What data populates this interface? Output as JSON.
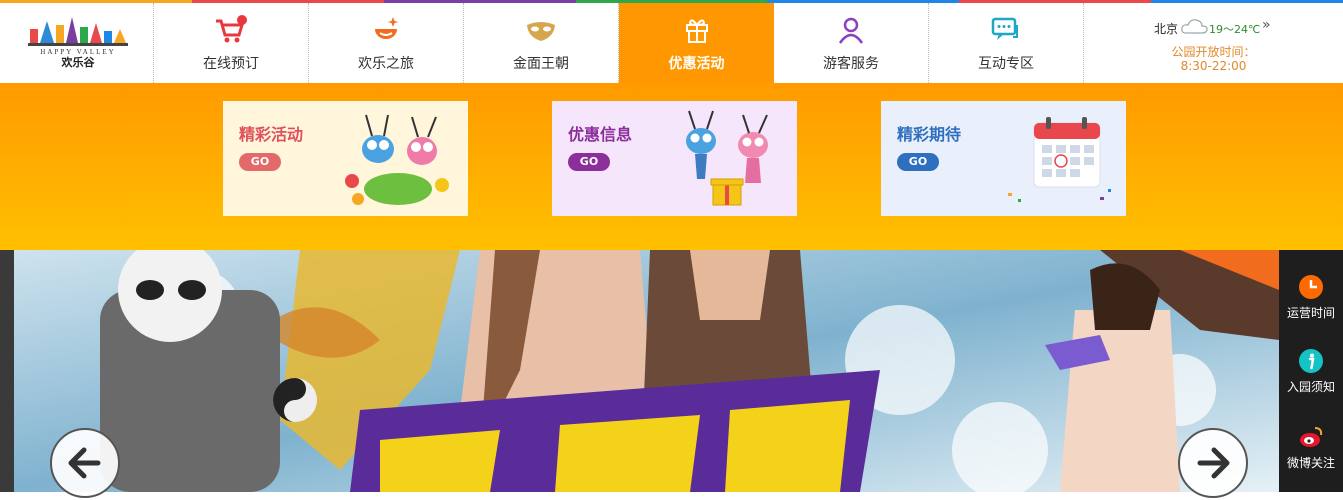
{
  "colors": {
    "stripe": [
      "#f5a623",
      "#e84a4a",
      "#7b3fa0",
      "#2ea84a",
      "#1e88e5",
      "#e84a4a",
      "#1e88e5"
    ],
    "active_nav": "#ff9800",
    "dropdown_top": "#ff9a00",
    "dropdown_bottom": "#ffc000",
    "sidebar_bg": "#1e1e1e"
  },
  "logo": {
    "text_en": "HAPPY VALLEY",
    "text_cn": "欢乐谷"
  },
  "nav": [
    {
      "label": "在线预订",
      "icon": "shopping-cart-icon"
    },
    {
      "label": "欢乐之旅",
      "icon": "sparkle-smile-icon"
    },
    {
      "label": "金面王朝",
      "icon": "golden-mask-icon"
    },
    {
      "label": "优惠活动",
      "icon": "gift-icon"
    },
    {
      "label": "游客服务",
      "icon": "person-icon"
    },
    {
      "label": "互动专区",
      "icon": "chat-bubbles-icon"
    }
  ],
  "weather": {
    "city": "北京",
    "temp": "19～24℃",
    "more": "»",
    "hours_label": "公园开放时间：",
    "hours": "8:30-22:00",
    "icon": "cloud-icon"
  },
  "promo_cards": [
    {
      "title": "精彩活动",
      "go": "GO",
      "bg": "#fff6dc",
      "title_color": "#e0505a",
      "go_color": "#e36a6a",
      "art": "ant-mascots-flowers-illustration"
    },
    {
      "title": "优惠信息",
      "go": "GO",
      "bg": "#f6e6fb",
      "title_color": "#8b2f9b",
      "go_color": "#8b2f9b",
      "art": "ant-mascots-gift-illustration"
    },
    {
      "title": "精彩期待",
      "go": "GO",
      "bg": "#eaf0fb",
      "title_color": "#2f6fbf",
      "go_color": "#2f6fbf",
      "art": "calendar-illustration"
    }
  ],
  "sidebar": [
    {
      "label": "运营时间",
      "icon": "clock-icon",
      "color": "#ff6a00"
    },
    {
      "label": "入园须知",
      "icon": "info-icon",
      "color": "#14c4c4"
    },
    {
      "label": "微博关注",
      "icon": "weibo-icon",
      "color": "#e6162d"
    }
  ],
  "banner": {
    "image": "carnival-poster-image",
    "prev": "←",
    "next": "→"
  }
}
